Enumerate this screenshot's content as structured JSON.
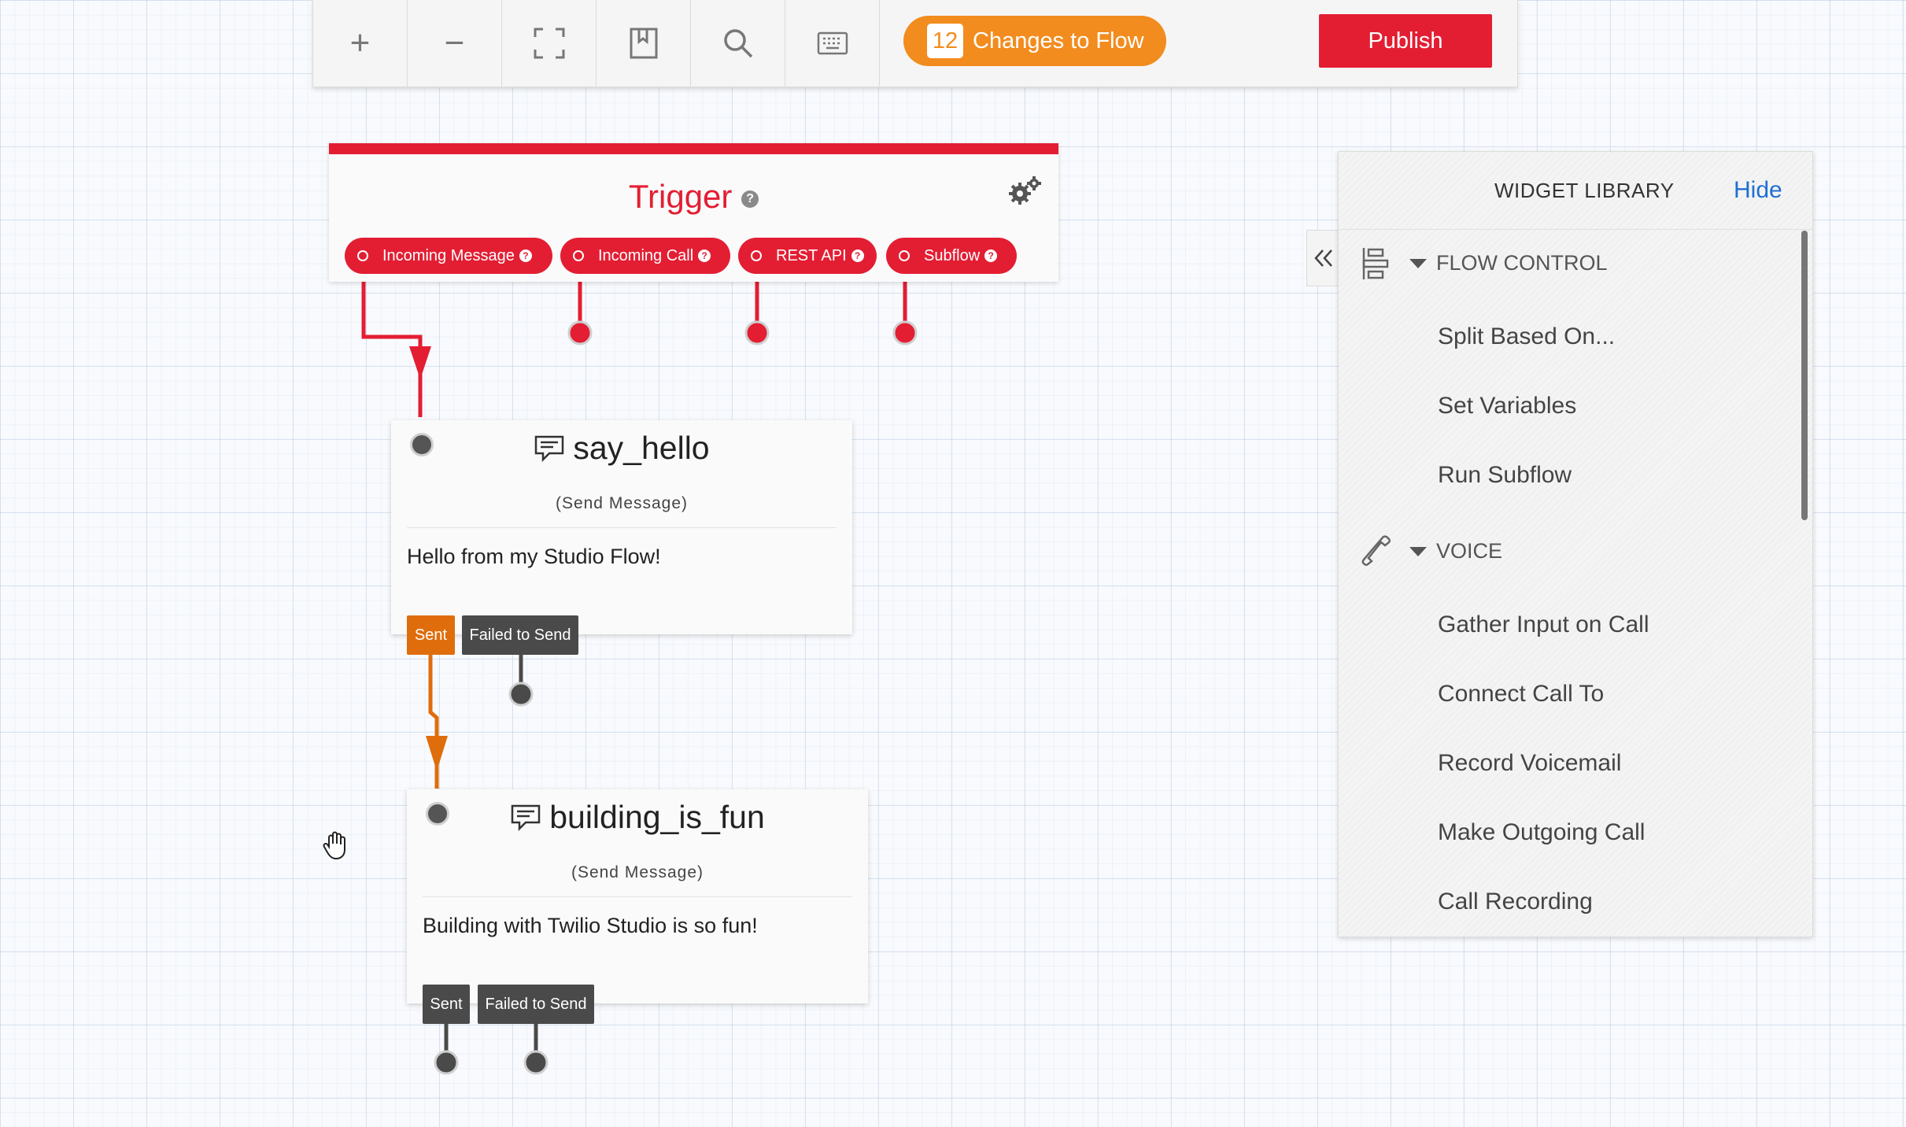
{
  "toolbar": {
    "zoom_in": "+",
    "zoom_out": "−",
    "changes_count": "12",
    "changes_label": "Changes to Flow",
    "publish_label": "Publish",
    "icons": [
      "plus-icon",
      "minus-icon",
      "fullscreen-icon",
      "bookmark-icon",
      "search-icon",
      "keyboard-icon"
    ]
  },
  "trigger": {
    "title": "Trigger",
    "help": "?",
    "triggers": [
      {
        "label": "Incoming Message"
      },
      {
        "label": "Incoming Call"
      },
      {
        "label": "REST API"
      },
      {
        "label": "Subflow"
      }
    ]
  },
  "widgets": [
    {
      "name": "say_hello",
      "type": "(Send Message)",
      "body": "Hello from my Studio Flow!",
      "outputs": [
        "Sent",
        "Failed to Send"
      ]
    },
    {
      "name": "building_is_fun",
      "type": "(Send Message)",
      "body": "Building with Twilio Studio is so fun!",
      "outputs": [
        "Sent",
        "Failed to Send"
      ]
    }
  ],
  "library": {
    "title": "WIDGET LIBRARY",
    "hide": "Hide",
    "sections": [
      {
        "name": "FLOW CONTROL",
        "items": [
          "Split Based On...",
          "Set Variables",
          "Run Subflow"
        ]
      },
      {
        "name": "VOICE",
        "items": [
          "Gather Input on Call",
          "Connect Call To",
          "Record Voicemail",
          "Make Outgoing Call",
          "Call Recording"
        ]
      }
    ]
  },
  "colors": {
    "brand_red": "#e31e33",
    "changes_orange": "#f28c1e",
    "sent_orange": "#e06d0b",
    "link_blue": "#1f6fd1",
    "dark_tag": "#4a4a4a"
  }
}
